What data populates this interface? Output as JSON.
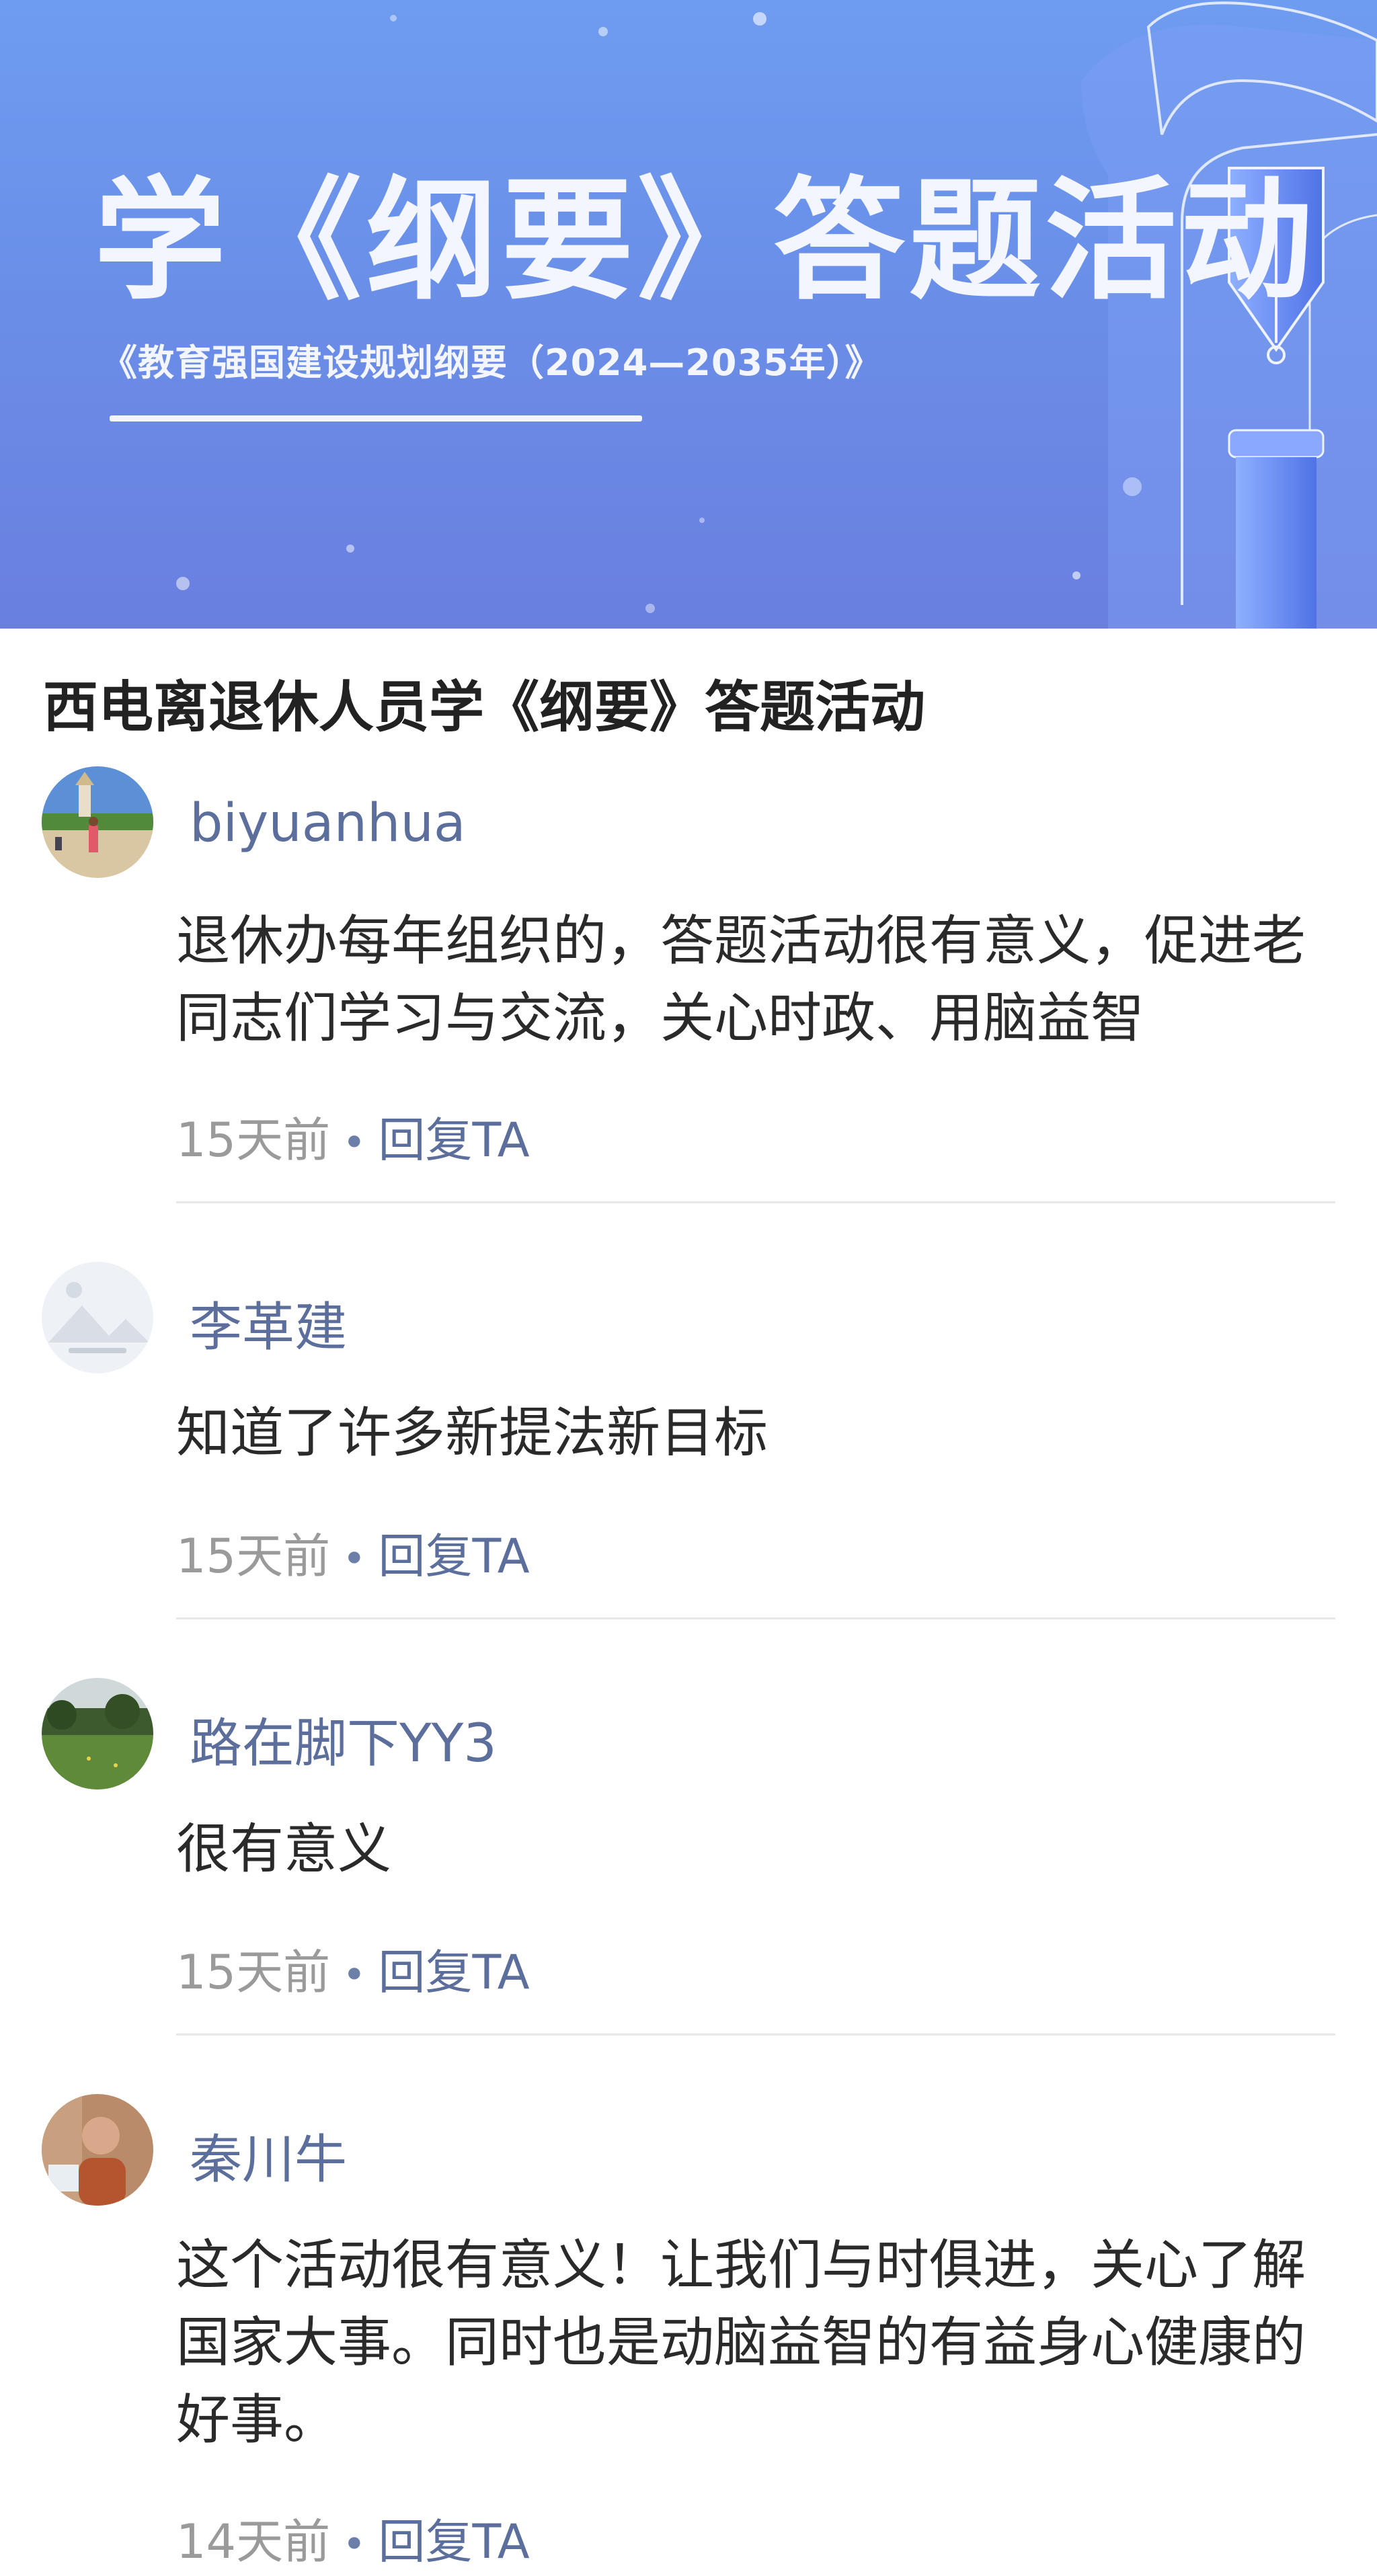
{
  "banner": {
    "title": "学《纲要》答题活动",
    "subtitle": "《教育强国建设规划纲要（2024—2035年）》"
  },
  "post": {
    "title": "西电离退休人员学《纲要》答题活动"
  },
  "comments": [
    {
      "user": "biyuanhua",
      "text": "退休办每年组织的，答题活动很有意义，促进老同志们学习与交流，关心时政、用脑益智",
      "time": "15天前",
      "reply": "回复TA"
    },
    {
      "user": "李革建",
      "text": "知道了许多新提法新目标",
      "time": "15天前",
      "reply": "回复TA"
    },
    {
      "user": "路在脚下YY3",
      "text": "很有意义",
      "time": "15天前",
      "reply": "回复TA"
    },
    {
      "user": "秦川牛",
      "text": "这个活动很有意义！让我们与时俱进，关心了解国家大事。同时也是动脑益智的有益身心健康的好事。",
      "time": "14天前",
      "reply": "回复TA"
    }
  ],
  "meta_separator": "•",
  "icons": {
    "avatar_1": "beach-photo-avatar",
    "avatar_2": "image-placeholder-avatar",
    "avatar_3": "landscape-photo-avatar",
    "avatar_4": "person-photo-avatar"
  },
  "colors": {
    "banner_blue": "#6a8fe8",
    "username": "#5b6e9c",
    "reply_link": "#5b6e9c",
    "timestamp": "#9a9a9a"
  }
}
